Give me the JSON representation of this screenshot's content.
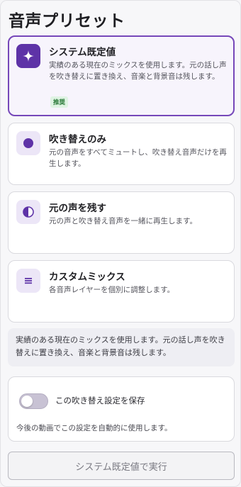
{
  "page_title": "音声プリセット",
  "presets": [
    {
      "icon": "sparkle-icon",
      "title": "システム既定値",
      "description": "実績のある現在のミックスを使用します。元の話し声を吹き替えに置き換え、音楽と背景音は残します。",
      "badge": "推奨",
      "selected": true
    },
    {
      "icon": "dot-icon",
      "title": "吹き替えのみ",
      "description": "元の音声をすべてミュートし、吹き替え音声だけを再生します。",
      "selected": false
    },
    {
      "icon": "half-circle-icon",
      "title": "元の声を残す",
      "description": "元の声と吹き替え音声を一緒に再生します。",
      "selected": false
    },
    {
      "icon": "sliders-icon",
      "title": "カスタムミックス",
      "description": "各音声レイヤーを個別に調整します。",
      "selected": false
    }
  ],
  "info_text": "実績のある現在のミックスを使用します。元の話し声を吹き替えに置き換え、音楽と背景音は残します。",
  "save_setting": {
    "label": "この吹き替え設定を保存",
    "enabled": false,
    "hint": "今後の動画でこの設定を自動的に使用します。"
  },
  "run_button_label": "システム既定値で実行",
  "colors": {
    "accent": "#5e33a7",
    "accent_border": "#7648b9",
    "badge_bg": "#dff3e3",
    "badge_text": "#2b7a3a"
  }
}
